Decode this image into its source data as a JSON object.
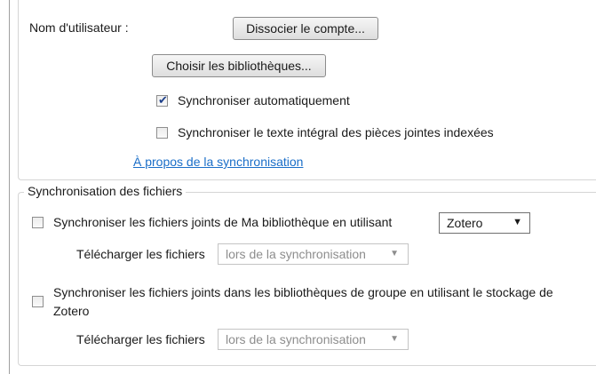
{
  "account": {
    "username_label": "Nom d'utilisateur :",
    "unlink_button": "Dissocier le compte...",
    "choose_libraries_button": "Choisir les bibliothèques...",
    "auto_sync_label": "Synchroniser automatiquement",
    "auto_sync_checked": true,
    "fulltext_sync_label": "Synchroniser le texte intégral des pièces jointes indexées",
    "fulltext_sync_checked": false,
    "about_link": "À propos de la synchronisation"
  },
  "file_sync": {
    "legend": "Synchronisation des fichiers",
    "my_library_label": "Synchroniser les fichiers joints de Ma bibliothèque en utilisant",
    "my_library_checked": false,
    "storage_selected": "Zotero",
    "download_label": "Télécharger les fichiers",
    "download_option": "lors de la synchronisation",
    "group_label_line1": "Synchroniser les fichiers joints dans les bibliothèques de groupe en utilisant le stockage de",
    "group_label_line2": "Zotero",
    "group_checked": false,
    "group_download_label": "Télécharger les fichiers",
    "group_download_option": "lors de la synchronisation"
  }
}
